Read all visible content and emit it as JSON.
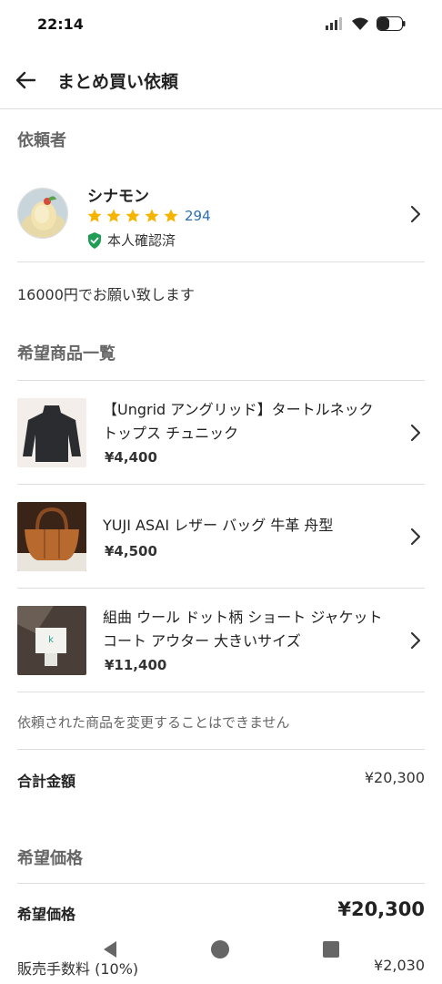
{
  "status_bar": {
    "time": "22:14"
  },
  "app_bar": {
    "title": "まとめ買い依頼"
  },
  "requester_section": {
    "title": "依頼者",
    "name": "シナモン",
    "rating_count": "294",
    "verified_label": "本人確認済"
  },
  "message": "16000円でお願い致します",
  "products_section": {
    "title": "希望商品一覧",
    "items": [
      {
        "title": "【Ungrid アングリッド】タートルネック トップス チュニック",
        "price": "¥4,400"
      },
      {
        "title": "YUJI ASAI レザー バッグ 牛革 舟型",
        "price": "¥4,500"
      },
      {
        "title": "組曲 ウール ドット柄 ショート ジャケット コート アウター 大きいサイズ",
        "price": "¥11,400"
      }
    ],
    "note": "依頼された商品を変更することはできません"
  },
  "total": {
    "label": "合計金額",
    "value": "¥20,300"
  },
  "desired_price_section": {
    "title": "希望価格",
    "label": "希望価格",
    "value": "¥20,300",
    "fee_label": "販売手数料 (10%)",
    "fee_value": "¥2,030"
  },
  "colors": {
    "accent_blue": "#2a6fb5",
    "star": "#f5b400",
    "verified_green": "#1f9d55"
  }
}
